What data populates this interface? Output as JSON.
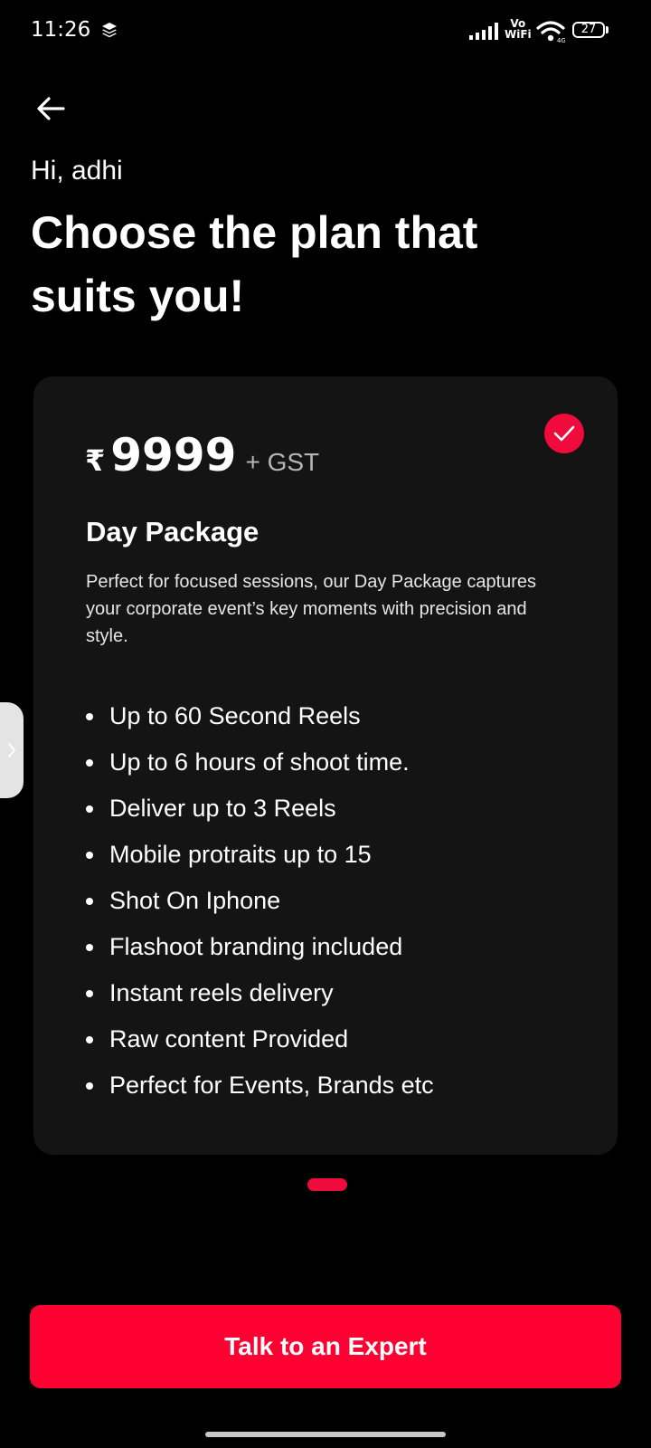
{
  "status_bar": {
    "time": "11:26",
    "network_line1": "Vo",
    "network_line2": "WiFi",
    "battery": "27",
    "icons": [
      "layers-icon",
      "signal-icon",
      "wifi-icon",
      "battery-icon"
    ]
  },
  "header": {
    "back_icon": "arrow-left-icon",
    "greeting": "Hi, adhi",
    "title": "Choose the plan that suits you!"
  },
  "plan": {
    "selected": true,
    "currency": "₹",
    "price": "9999",
    "price_suffix": "+ GST",
    "name": "Day Package",
    "description": "Perfect for focused sessions, our Day Package captures your corporate event’s key moments with precision and style.",
    "features": [
      "Up to 60 Second Reels",
      "Up to 6 hours of shoot time.",
      "Deliver up to 3 Reels",
      "Mobile protraits up to 15",
      "Shot On Iphone",
      "Flashoot branding included",
      "Instant reels delivery",
      "Raw content Provided",
      "Perfect for Events, Brands etc"
    ]
  },
  "pager": {
    "current_page": 1
  },
  "cta": {
    "label": "Talk to an Expert"
  },
  "colors": {
    "accent": "#ff0033",
    "card_bg": "#141414",
    "background": "#000000"
  }
}
